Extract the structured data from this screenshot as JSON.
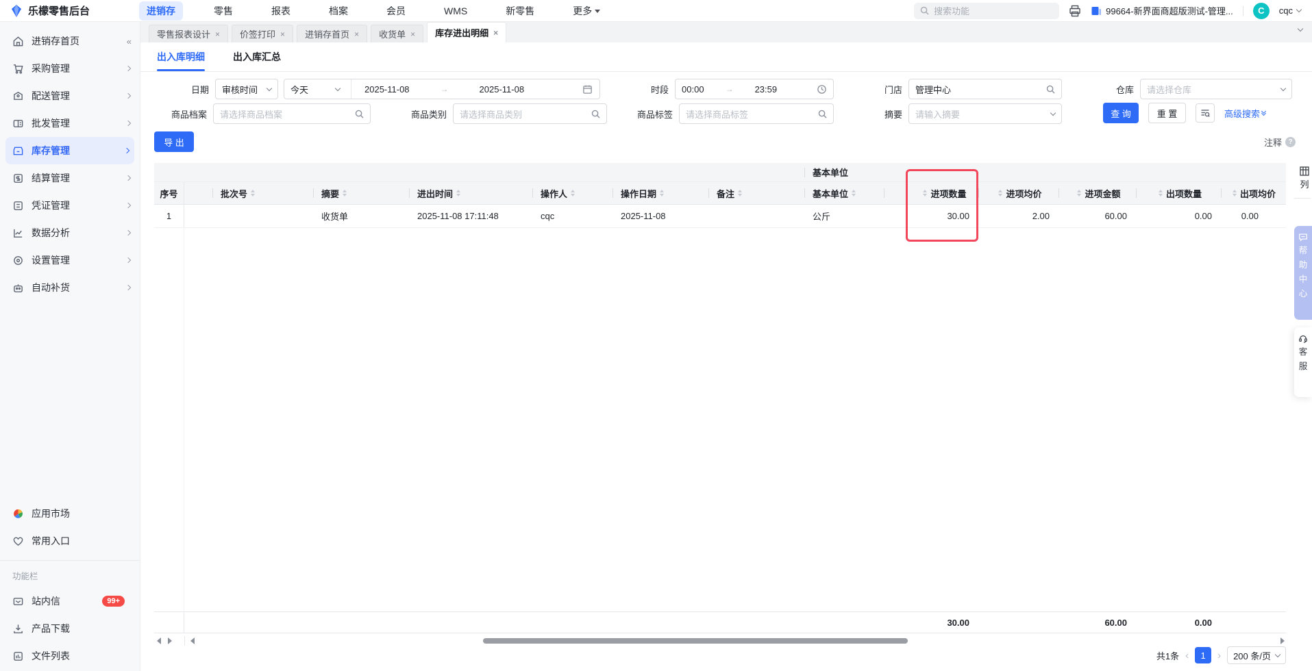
{
  "topbar": {
    "brand": "乐檬零售后台",
    "nav": [
      {
        "label": "进销存"
      },
      {
        "label": "零售"
      },
      {
        "label": "报表"
      },
      {
        "label": "档案"
      },
      {
        "label": "会员"
      },
      {
        "label": "WMS"
      },
      {
        "label": "新零售"
      },
      {
        "label": "更多"
      }
    ],
    "search_placeholder": "搜索功能",
    "store_name": "99664-新界面商超版测试-管理...",
    "avatar_letter": "C",
    "username": "cqc"
  },
  "sidebar": {
    "items": [
      {
        "label": "进销存首页"
      },
      {
        "label": "采购管理"
      },
      {
        "label": "配送管理"
      },
      {
        "label": "批发管理"
      },
      {
        "label": "库存管理"
      },
      {
        "label": "结算管理"
      },
      {
        "label": "凭证管理"
      },
      {
        "label": "数据分析"
      },
      {
        "label": "设置管理"
      },
      {
        "label": "自动补货"
      }
    ],
    "shortcuts": [
      {
        "label": "应用市场"
      },
      {
        "label": "常用入口"
      }
    ],
    "section_label": "功能栏",
    "tools": [
      {
        "label": "站内信",
        "badge": "99+"
      },
      {
        "label": "产品下载"
      },
      {
        "label": "文件列表"
      }
    ]
  },
  "tabs": [
    {
      "label": "零售报表设计"
    },
    {
      "label": "价签打印"
    },
    {
      "label": "进销存首页"
    },
    {
      "label": "收货单"
    },
    {
      "label": "库存进出明细"
    }
  ],
  "subtabs": [
    {
      "label": "出入库明细"
    },
    {
      "label": "出入库汇总"
    }
  ],
  "filters": {
    "date_label": "日期",
    "date_type": "审核时间",
    "date_preset": "今天",
    "date_from": "2025-11-08",
    "date_to": "2025-11-08",
    "time_label": "时段",
    "time_from": "00:00",
    "time_to": "23:59",
    "store_label": "门店",
    "store_value": "管理中心",
    "warehouse_label": "仓库",
    "warehouse_placeholder": "请选择仓库",
    "product_label": "商品档案",
    "product_placeholder": "请选择商品档案",
    "category_label": "商品类别",
    "category_placeholder": "请选择商品类别",
    "tag_label": "商品标签",
    "tag_placeholder": "请选择商品标签",
    "summary_label": "摘要",
    "summary_placeholder": "请输入摘要",
    "search_btn": "查 询",
    "reset_btn": "重 置",
    "advanced_link": "高级搜索"
  },
  "toolbar": {
    "export_btn": "导 出",
    "note_label": "注释"
  },
  "table": {
    "group_header": "基本单位",
    "columns": [
      "序号",
      "批次号",
      "摘要",
      "进出时间",
      "操作人",
      "操作日期",
      "备注",
      "基本单位",
      "进项数量",
      "进项均价",
      "进项金额",
      "出项数量",
      "出项均价"
    ],
    "rows": [
      {
        "index": "1",
        "batch_no": "",
        "summary": "收货单",
        "time": "2025-11-08 17:11:48",
        "operator": "cqc",
        "op_date": "2025-11-08",
        "remark": "",
        "base_unit": "公斤",
        "in_qty": "30.00",
        "in_price": "2.00",
        "in_amount": "60.00",
        "out_qty": "0.00",
        "out_price": "0.00"
      }
    ],
    "totals": {
      "in_qty": "30.00",
      "in_amount": "60.00",
      "out_qty": "0.00"
    }
  },
  "pagination": {
    "total": "共1条",
    "page": "1",
    "page_size": "200 条/页"
  },
  "side_panel": {
    "columns_btn": "列",
    "help": [
      "帮",
      "助",
      "中",
      "心"
    ],
    "service": [
      "客",
      "服"
    ]
  }
}
